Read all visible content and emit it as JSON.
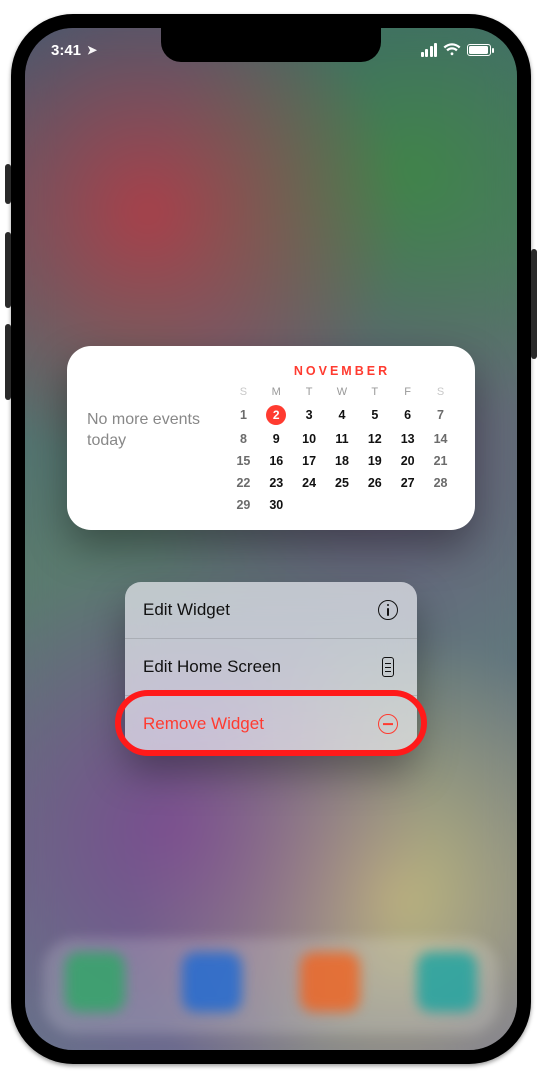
{
  "status": {
    "time": "3:41",
    "location_arrow": "↗"
  },
  "widget": {
    "no_events": "No more events today",
    "month": "NOVEMBER",
    "dow": [
      "S",
      "M",
      "T",
      "W",
      "T",
      "F",
      "S"
    ],
    "weeks": [
      [
        "1",
        "2",
        "3",
        "4",
        "5",
        "6",
        "7"
      ],
      [
        "8",
        "9",
        "10",
        "11",
        "12",
        "13",
        "14"
      ],
      [
        "15",
        "16",
        "17",
        "18",
        "19",
        "20",
        "21"
      ],
      [
        "22",
        "23",
        "24",
        "25",
        "26",
        "27",
        "28"
      ],
      [
        "29",
        "30",
        "",
        "",
        "",
        "",
        ""
      ]
    ],
    "today": "2"
  },
  "menu": {
    "items": [
      {
        "label": "Edit Widget",
        "icon": "info",
        "danger": false
      },
      {
        "label": "Edit Home Screen",
        "icon": "screens",
        "danger": false
      },
      {
        "label": "Remove Widget",
        "icon": "remove",
        "danger": true
      }
    ]
  }
}
